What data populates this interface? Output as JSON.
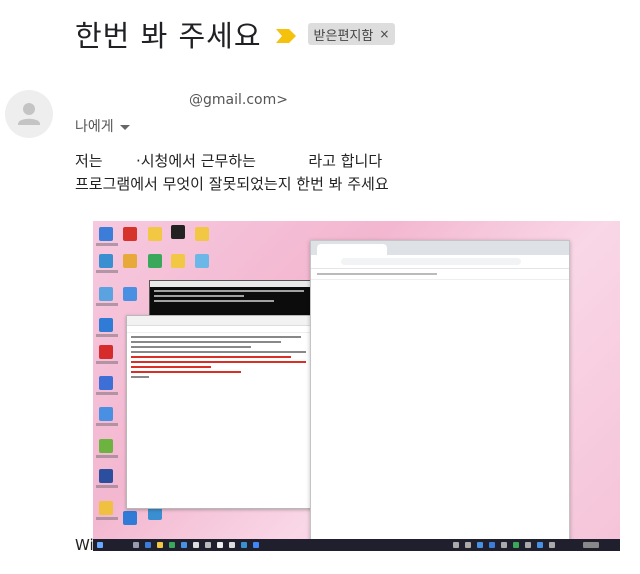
{
  "email": {
    "subject": "한번 봐 주세요",
    "label": "받은편지함",
    "label_remove": "×",
    "sender_email": "@gmail.com>",
    "to_line": "나에게",
    "body_line1": "저는       ·시청에서 근무하는           라고 합니다",
    "body_line2": "프로그램에서 무엇이 잘못되었는지 한번 봐 주세요",
    "trailing_text": "Wi"
  },
  "icons": {
    "importance": "importance-marker-icon",
    "avatar": "person-icon",
    "dropdown": "chevron-down-icon"
  },
  "colors": {
    "importance": "#f4c20d",
    "chip_bg": "#dddddd",
    "desktop_bg": "#f6c9de",
    "idle_error_text": "#d93025",
    "taskbar": "#1f1f2e"
  }
}
